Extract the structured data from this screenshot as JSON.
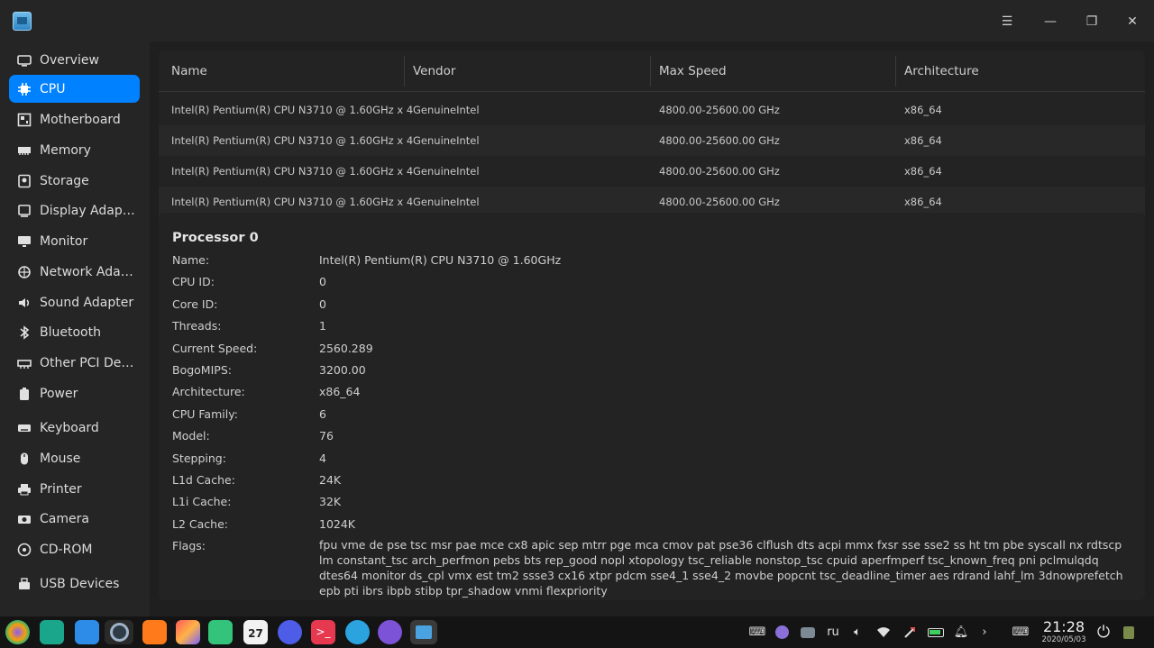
{
  "sidebar": {
    "items": [
      {
        "label": "Overview",
        "icon": "overview-icon"
      },
      {
        "label": "CPU",
        "icon": "cpu-icon",
        "active": true
      },
      {
        "label": "Motherboard",
        "icon": "motherboard-icon"
      },
      {
        "label": "Memory",
        "icon": "memory-icon"
      },
      {
        "label": "Storage",
        "icon": "storage-icon"
      },
      {
        "label": "Display Adapter",
        "icon": "display-adapter-icon"
      },
      {
        "label": "Monitor",
        "icon": "monitor-icon"
      },
      {
        "label": "Network Adapt...",
        "icon": "network-icon"
      },
      {
        "label": "Sound Adapter",
        "icon": "sound-icon"
      },
      {
        "label": "Bluetooth",
        "icon": "bluetooth-icon"
      },
      {
        "label": "Other PCI Devi...",
        "icon": "pci-icon"
      },
      {
        "label": "Power",
        "icon": "power-icon"
      },
      {
        "label": "Keyboard",
        "icon": "keyboard-icon"
      },
      {
        "label": "Mouse",
        "icon": "mouse-icon"
      },
      {
        "label": "Printer",
        "icon": "printer-icon"
      },
      {
        "label": "Camera",
        "icon": "camera-icon"
      },
      {
        "label": "CD-ROM",
        "icon": "cdrom-icon"
      },
      {
        "label": "USB Devices",
        "icon": "usb-icon"
      }
    ]
  },
  "table": {
    "headers": [
      "Name",
      "Vendor",
      "Max Speed",
      "Architecture"
    ],
    "rows": [
      [
        "Intel(R) Pentium(R) CPU N3710 @ 1.60GHz x 4",
        "GenuineIntel",
        "4800.00-25600.00 GHz",
        "x86_64"
      ],
      [
        "Intel(R) Pentium(R) CPU N3710 @ 1.60GHz x 4",
        "GenuineIntel",
        "4800.00-25600.00 GHz",
        "x86_64"
      ],
      [
        "Intel(R) Pentium(R) CPU N3710 @ 1.60GHz x 4",
        "GenuineIntel",
        "4800.00-25600.00 GHz",
        "x86_64"
      ],
      [
        "Intel(R) Pentium(R) CPU N3710 @ 1.60GHz x 4",
        "GenuineIntel",
        "4800.00-25600.00 GHz",
        "x86_64"
      ]
    ]
  },
  "detail": {
    "title": "Processor 0",
    "fields": [
      {
        "key": "Name:",
        "value": "Intel(R) Pentium(R) CPU N3710 @ 1.60GHz"
      },
      {
        "key": "CPU ID:",
        "value": "0"
      },
      {
        "key": "Core ID:",
        "value": "0"
      },
      {
        "key": "Threads:",
        "value": "1"
      },
      {
        "key": "Current Speed:",
        "value": "2560.289"
      },
      {
        "key": "BogoMIPS:",
        "value": "3200.00"
      },
      {
        "key": "Architecture:",
        "value": "x86_64"
      },
      {
        "key": "CPU Family:",
        "value": "6"
      },
      {
        "key": "Model:",
        "value": "76"
      },
      {
        "key": "Stepping:",
        "value": "4"
      },
      {
        "key": "L1d Cache:",
        "value": "24K"
      },
      {
        "key": "L1i Cache:",
        "value": "32K"
      },
      {
        "key": "L2 Cache:",
        "value": "1024K"
      }
    ],
    "flags_key": "Flags:",
    "flags_value": "fpu vme de pse tsc msr pae mce cx8 apic sep mtrr pge mca cmov pat pse36 clflush dts acpi mmx fxsr sse sse2 ss ht tm pbe syscall nx rdtscp lm constant_tsc arch_perfmon pebs bts rep_good nopl xtopology tsc_reliable nonstop_tsc cpuid aperfmperf tsc_known_freq pni pclmulqdq dtes64 monitor ds_cpl vmx est tm2 ssse3 cx16 xtpr pdcm sse4_1 sse4_2 movbe popcnt tsc_deadline_timer aes rdrand lahf_lm 3dnowprefetch epb pti ibrs ibpb stibp tpr_shadow vnmi flexpriority"
  },
  "taskbar": {
    "calendar_day": "27",
    "language": "ru",
    "clock_time": "21:28",
    "clock_date": "2020/05/03"
  },
  "colors": {
    "accent": "#0081ff",
    "background": "#1f1f1f"
  }
}
